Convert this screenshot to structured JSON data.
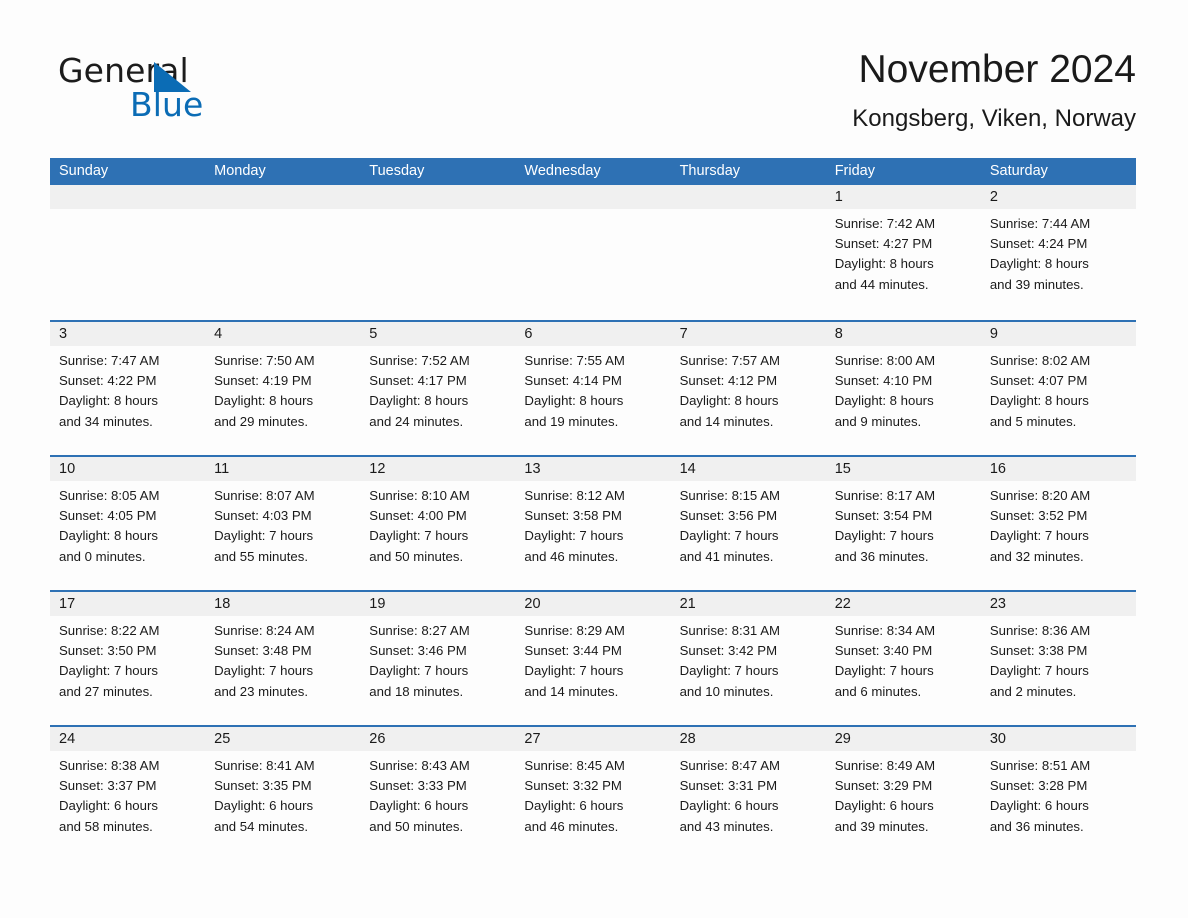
{
  "brand": {
    "name_part1": "General",
    "name_part2": "Blue",
    "triangle_color": "#0b6cb5"
  },
  "header": {
    "title": "November 2024",
    "subtitle": "Kongsberg, Viken, Norway"
  },
  "theme": {
    "accent": "#2e71b4",
    "daynum_band": "#f0f0f0",
    "page_background": "#fdfdfd",
    "text": "#1a1a1a",
    "header_text": "#ffffff"
  },
  "weekdays": [
    "Sunday",
    "Monday",
    "Tuesday",
    "Wednesday",
    "Thursday",
    "Friday",
    "Saturday"
  ],
  "weeks": [
    [
      {
        "day": "",
        "lines": []
      },
      {
        "day": "",
        "lines": []
      },
      {
        "day": "",
        "lines": []
      },
      {
        "day": "",
        "lines": []
      },
      {
        "day": "",
        "lines": []
      },
      {
        "day": "1",
        "lines": [
          "Sunrise: 7:42 AM",
          "Sunset: 4:27 PM",
          "Daylight: 8 hours",
          "and 44 minutes."
        ]
      },
      {
        "day": "2",
        "lines": [
          "Sunrise: 7:44 AM",
          "Sunset: 4:24 PM",
          "Daylight: 8 hours",
          "and 39 minutes."
        ]
      }
    ],
    [
      {
        "day": "3",
        "lines": [
          "Sunrise: 7:47 AM",
          "Sunset: 4:22 PM",
          "Daylight: 8 hours",
          "and 34 minutes."
        ]
      },
      {
        "day": "4",
        "lines": [
          "Sunrise: 7:50 AM",
          "Sunset: 4:19 PM",
          "Daylight: 8 hours",
          "and 29 minutes."
        ]
      },
      {
        "day": "5",
        "lines": [
          "Sunrise: 7:52 AM",
          "Sunset: 4:17 PM",
          "Daylight: 8 hours",
          "and 24 minutes."
        ]
      },
      {
        "day": "6",
        "lines": [
          "Sunrise: 7:55 AM",
          "Sunset: 4:14 PM",
          "Daylight: 8 hours",
          "and 19 minutes."
        ]
      },
      {
        "day": "7",
        "lines": [
          "Sunrise: 7:57 AM",
          "Sunset: 4:12 PM",
          "Daylight: 8 hours",
          "and 14 minutes."
        ]
      },
      {
        "day": "8",
        "lines": [
          "Sunrise: 8:00 AM",
          "Sunset: 4:10 PM",
          "Daylight: 8 hours",
          "and 9 minutes."
        ]
      },
      {
        "day": "9",
        "lines": [
          "Sunrise: 8:02 AM",
          "Sunset: 4:07 PM",
          "Daylight: 8 hours",
          "and 5 minutes."
        ]
      }
    ],
    [
      {
        "day": "10",
        "lines": [
          "Sunrise: 8:05 AM",
          "Sunset: 4:05 PM",
          "Daylight: 8 hours",
          "and 0 minutes."
        ]
      },
      {
        "day": "11",
        "lines": [
          "Sunrise: 8:07 AM",
          "Sunset: 4:03 PM",
          "Daylight: 7 hours",
          "and 55 minutes."
        ]
      },
      {
        "day": "12",
        "lines": [
          "Sunrise: 8:10 AM",
          "Sunset: 4:00 PM",
          "Daylight: 7 hours",
          "and 50 minutes."
        ]
      },
      {
        "day": "13",
        "lines": [
          "Sunrise: 8:12 AM",
          "Sunset: 3:58 PM",
          "Daylight: 7 hours",
          "and 46 minutes."
        ]
      },
      {
        "day": "14",
        "lines": [
          "Sunrise: 8:15 AM",
          "Sunset: 3:56 PM",
          "Daylight: 7 hours",
          "and 41 minutes."
        ]
      },
      {
        "day": "15",
        "lines": [
          "Sunrise: 8:17 AM",
          "Sunset: 3:54 PM",
          "Daylight: 7 hours",
          "and 36 minutes."
        ]
      },
      {
        "day": "16",
        "lines": [
          "Sunrise: 8:20 AM",
          "Sunset: 3:52 PM",
          "Daylight: 7 hours",
          "and 32 minutes."
        ]
      }
    ],
    [
      {
        "day": "17",
        "lines": [
          "Sunrise: 8:22 AM",
          "Sunset: 3:50 PM",
          "Daylight: 7 hours",
          "and 27 minutes."
        ]
      },
      {
        "day": "18",
        "lines": [
          "Sunrise: 8:24 AM",
          "Sunset: 3:48 PM",
          "Daylight: 7 hours",
          "and 23 minutes."
        ]
      },
      {
        "day": "19",
        "lines": [
          "Sunrise: 8:27 AM",
          "Sunset: 3:46 PM",
          "Daylight: 7 hours",
          "and 18 minutes."
        ]
      },
      {
        "day": "20",
        "lines": [
          "Sunrise: 8:29 AM",
          "Sunset: 3:44 PM",
          "Daylight: 7 hours",
          "and 14 minutes."
        ]
      },
      {
        "day": "21",
        "lines": [
          "Sunrise: 8:31 AM",
          "Sunset: 3:42 PM",
          "Daylight: 7 hours",
          "and 10 minutes."
        ]
      },
      {
        "day": "22",
        "lines": [
          "Sunrise: 8:34 AM",
          "Sunset: 3:40 PM",
          "Daylight: 7 hours",
          "and 6 minutes."
        ]
      },
      {
        "day": "23",
        "lines": [
          "Sunrise: 8:36 AM",
          "Sunset: 3:38 PM",
          "Daylight: 7 hours",
          "and 2 minutes."
        ]
      }
    ],
    [
      {
        "day": "24",
        "lines": [
          "Sunrise: 8:38 AM",
          "Sunset: 3:37 PM",
          "Daylight: 6 hours",
          "and 58 minutes."
        ]
      },
      {
        "day": "25",
        "lines": [
          "Sunrise: 8:41 AM",
          "Sunset: 3:35 PM",
          "Daylight: 6 hours",
          "and 54 minutes."
        ]
      },
      {
        "day": "26",
        "lines": [
          "Sunrise: 8:43 AM",
          "Sunset: 3:33 PM",
          "Daylight: 6 hours",
          "and 50 minutes."
        ]
      },
      {
        "day": "27",
        "lines": [
          "Sunrise: 8:45 AM",
          "Sunset: 3:32 PM",
          "Daylight: 6 hours",
          "and 46 minutes."
        ]
      },
      {
        "day": "28",
        "lines": [
          "Sunrise: 8:47 AM",
          "Sunset: 3:31 PM",
          "Daylight: 6 hours",
          "and 43 minutes."
        ]
      },
      {
        "day": "29",
        "lines": [
          "Sunrise: 8:49 AM",
          "Sunset: 3:29 PM",
          "Daylight: 6 hours",
          "and 39 minutes."
        ]
      },
      {
        "day": "30",
        "lines": [
          "Sunrise: 8:51 AM",
          "Sunset: 3:28 PM",
          "Daylight: 6 hours",
          "and 36 minutes."
        ]
      }
    ]
  ]
}
